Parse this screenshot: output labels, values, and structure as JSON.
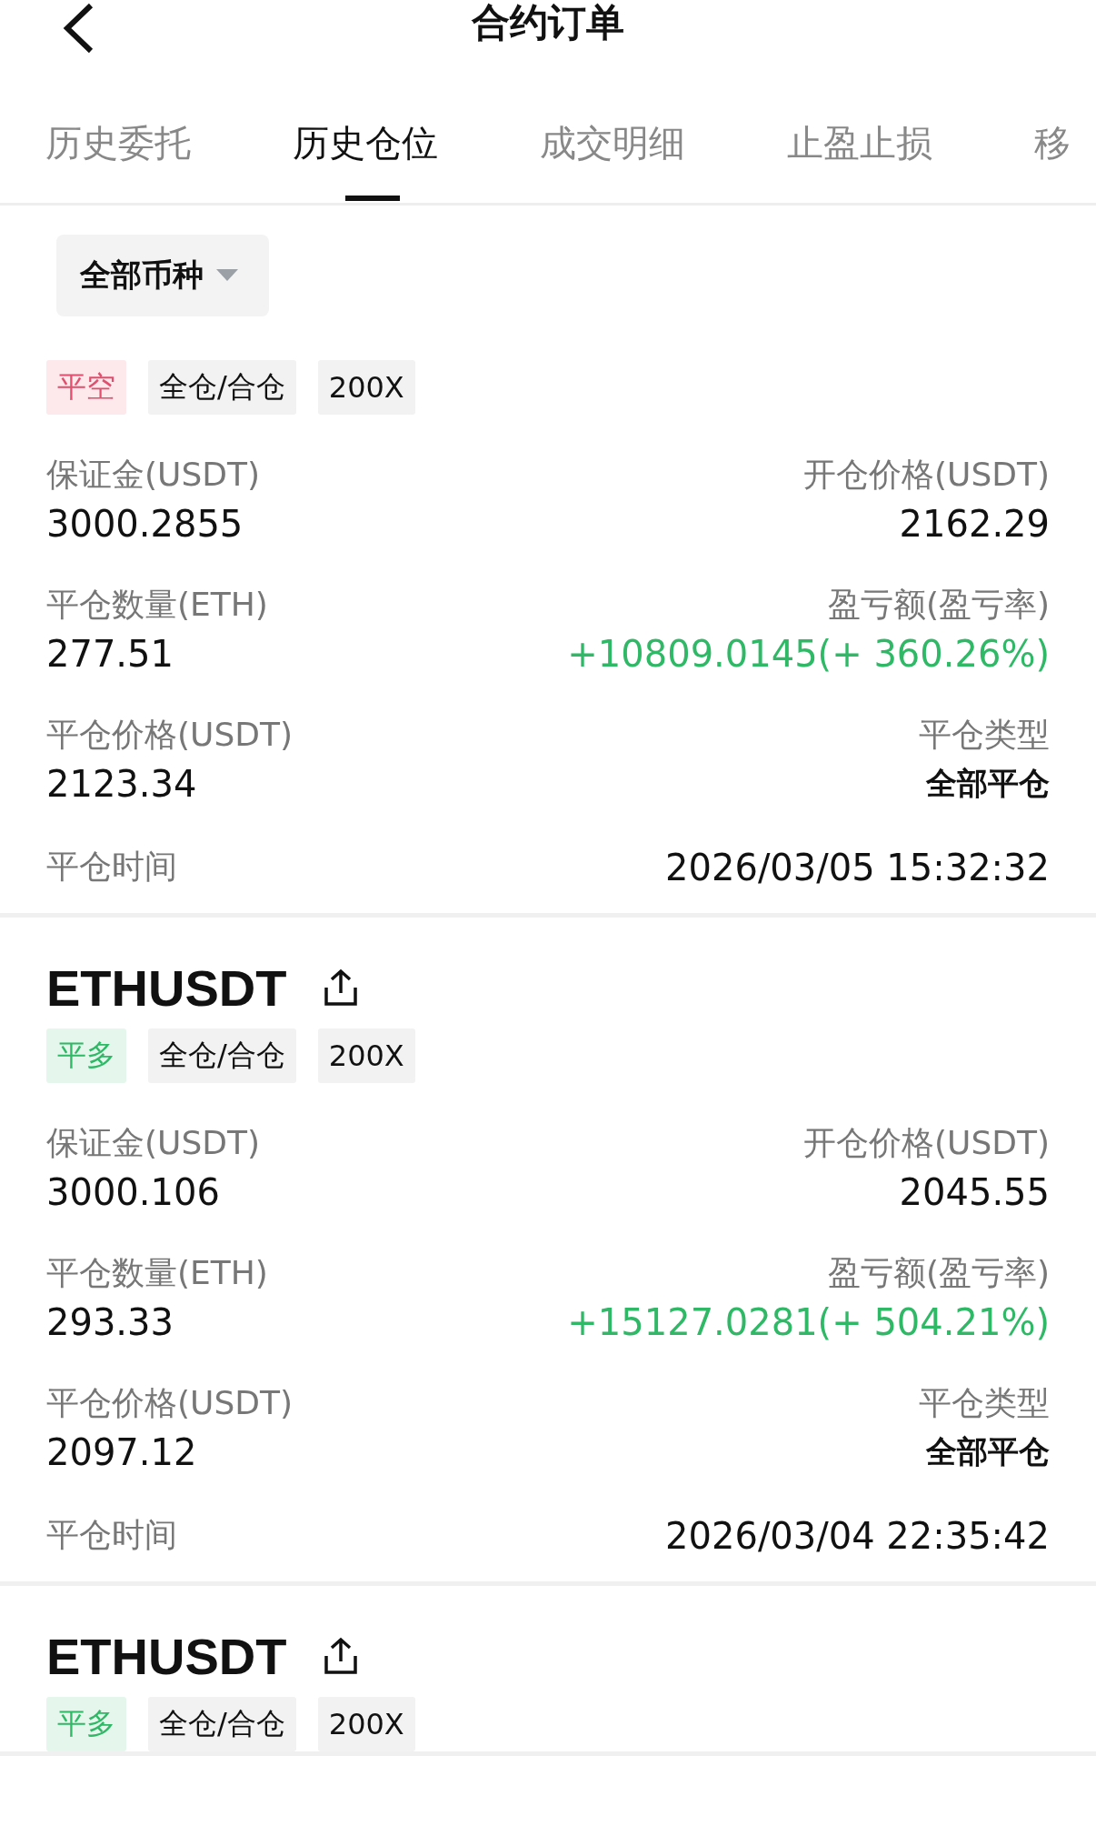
{
  "header": {
    "title": "合约订单"
  },
  "tabs": [
    {
      "label": "历史委托",
      "selected": false
    },
    {
      "label": "历史仓位",
      "selected": true
    },
    {
      "label": "成交明细",
      "selected": false
    },
    {
      "label": "止盈止损",
      "selected": false
    },
    {
      "label": "移",
      "selected": false
    }
  ],
  "filter": {
    "label": "全部币种"
  },
  "positions": [
    {
      "side": {
        "label": "平空",
        "kind": "short"
      },
      "tags": [
        "全仓/合仓",
        "200X"
      ],
      "rows": [
        {
          "kind": "pair",
          "left": {
            "label": "保证金(USDT)",
            "value": "3000.2855"
          },
          "right": {
            "label": "开仓价格(USDT)",
            "value": "2162.29"
          }
        },
        {
          "kind": "pair",
          "left": {
            "label": "平仓数量(ETH)",
            "value": "277.51"
          },
          "right": {
            "label": "盈亏额(盈亏率)",
            "value": "+10809.0145(+ 360.26%)",
            "kind": "gain"
          }
        },
        {
          "kind": "pair",
          "left": {
            "label": "平仓价格(USDT)",
            "value": "2123.34"
          },
          "right": {
            "label": "平仓类型",
            "value": "全部平仓",
            "kind": "strong"
          }
        },
        {
          "kind": "inline",
          "label": "平仓时间",
          "value": "2026/03/05 15:32:32"
        }
      ]
    },
    {
      "title": "ETHUSDT",
      "side": {
        "label": "平多",
        "kind": "long"
      },
      "tags": [
        "全仓/合仓",
        "200X"
      ],
      "rows": [
        {
          "kind": "pair",
          "left": {
            "label": "保证金(USDT)",
            "value": "3000.106"
          },
          "right": {
            "label": "开仓价格(USDT)",
            "value": "2045.55"
          }
        },
        {
          "kind": "pair",
          "left": {
            "label": "平仓数量(ETH)",
            "value": "293.33"
          },
          "right": {
            "label": "盈亏额(盈亏率)",
            "value": "+15127.0281(+ 504.21%)",
            "kind": "gain"
          }
        },
        {
          "kind": "pair",
          "left": {
            "label": "平仓价格(USDT)",
            "value": "2097.12"
          },
          "right": {
            "label": "平仓类型",
            "value": "全部平仓",
            "kind": "strong"
          }
        },
        {
          "kind": "inline",
          "label": "平仓时间",
          "value": "2026/03/04 22:35:42"
        }
      ]
    },
    {
      "title": "ETHUSDT",
      "side": {
        "label": "平多",
        "kind": "long"
      },
      "tags": [
        "全仓/合仓",
        "200X"
      ]
    }
  ]
}
